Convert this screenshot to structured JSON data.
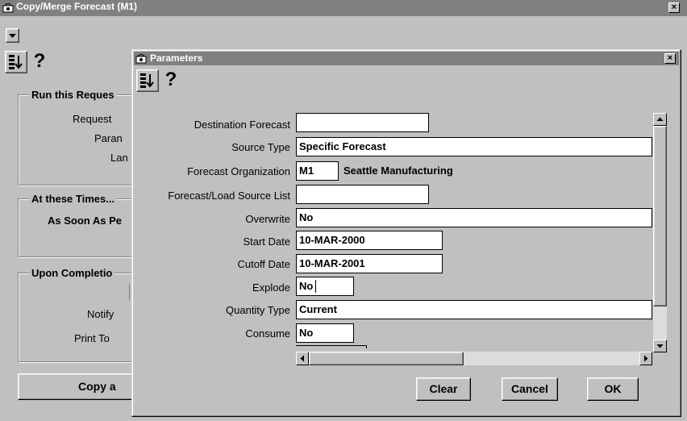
{
  "main_window": {
    "title": "Copy/Merge Forecast (M1)",
    "close_glyph": "×",
    "groups": {
      "run": {
        "title": "Run this Reques",
        "labels": [
          "Request",
          "Paran",
          "Lan"
        ]
      },
      "times": {
        "title": "At these Times...",
        "value": "As Soon As Pe"
      },
      "completion": {
        "title": "Upon Completio",
        "notify_label": "Notify",
        "print_label": "Print To"
      }
    },
    "copy_button": "Copy a"
  },
  "dialog": {
    "title": "Parameters",
    "close_glyph": "×",
    "help_glyph": "?",
    "fields": [
      {
        "label": "Destination Forecast",
        "value": ""
      },
      {
        "label": "Source Type",
        "value": "Specific Forecast"
      },
      {
        "label": "Forecast Organization",
        "value": "M1",
        "extra": "Seattle Manufacturing"
      },
      {
        "label": "Forecast/Load Source List",
        "value": ""
      },
      {
        "label": "Overwrite",
        "value": "No"
      },
      {
        "label": "Start Date",
        "value": "10-MAR-2000"
      },
      {
        "label": "Cutoff Date",
        "value": "10-MAR-2001"
      },
      {
        "label": "Explode",
        "value": "No"
      },
      {
        "label": "Quantity Type",
        "value": "Current"
      },
      {
        "label": "Consume",
        "value": "No"
      }
    ],
    "buttons": {
      "clear": "Clear",
      "cancel": "Cancel",
      "ok": "OK"
    }
  },
  "toolbar": {
    "help_glyph": "?"
  },
  "icons": [
    "app-icon",
    "list-of-values-icon",
    "help-icon",
    "close-icon",
    "dropdown-arrow-icon",
    "scroll-up-icon",
    "scroll-down-icon",
    "scroll-left-icon",
    "scroll-right-icon"
  ]
}
